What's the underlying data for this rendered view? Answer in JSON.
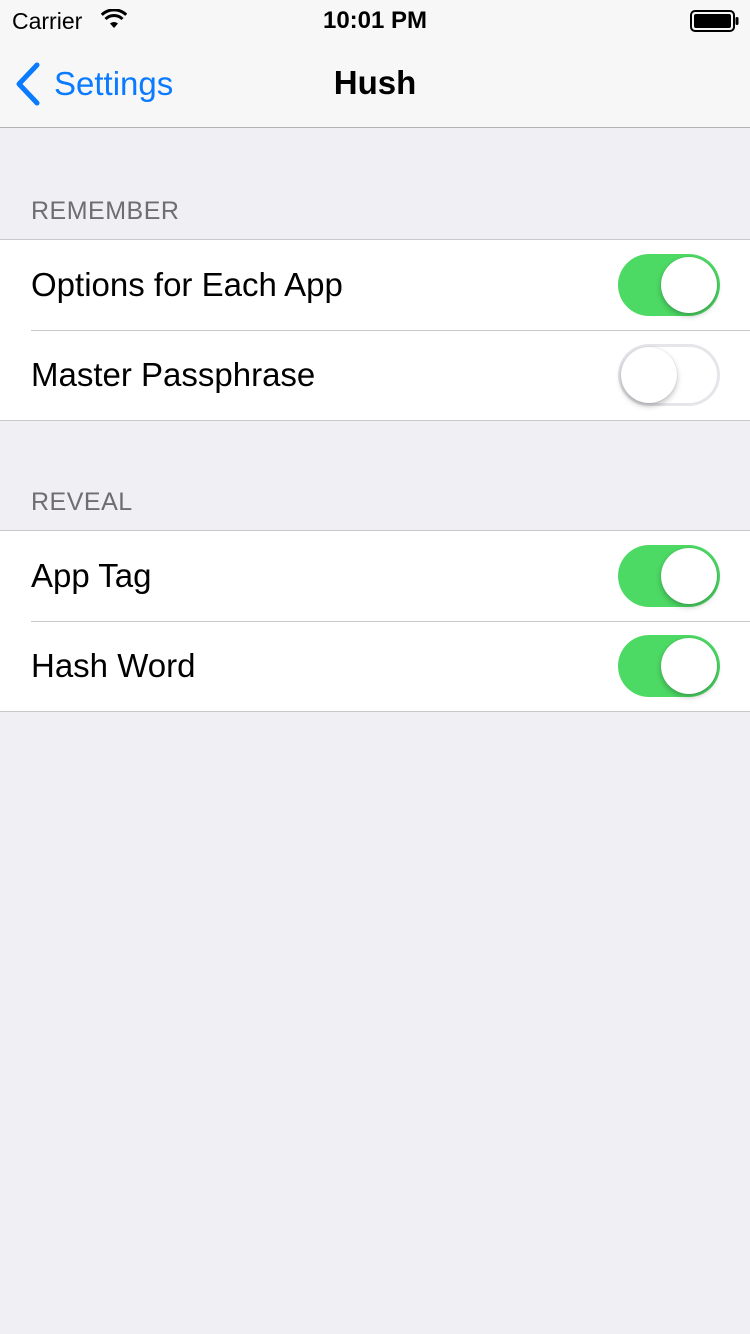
{
  "status_bar": {
    "carrier": "Carrier",
    "time": "10:01 PM"
  },
  "nav": {
    "back_label": "Settings",
    "title": "Hush"
  },
  "sections": [
    {
      "header": "REMEMBER",
      "rows": [
        {
          "label": "Options for Each App",
          "enabled": true
        },
        {
          "label": "Master Passphrase",
          "enabled": false
        }
      ]
    },
    {
      "header": "REVEAL",
      "rows": [
        {
          "label": "App Tag",
          "enabled": true
        },
        {
          "label": "Hash Word",
          "enabled": true
        }
      ]
    }
  ],
  "colors": {
    "accent": "#0a7aff",
    "toggle_on": "#4cd964",
    "background": "#efeff4"
  },
  "icons": {
    "wifi": "wifi-icon",
    "battery": "battery-icon",
    "back": "chevron-left-icon"
  }
}
